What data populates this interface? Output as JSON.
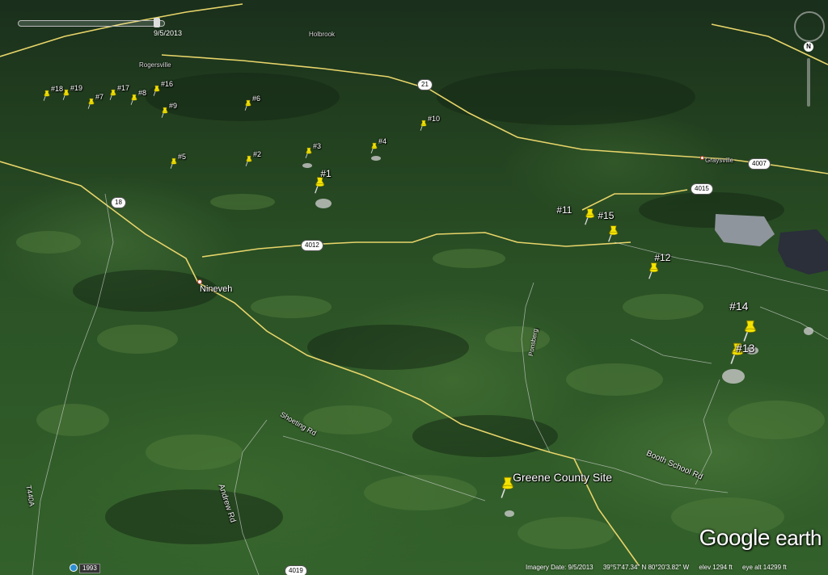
{
  "app": {
    "name": "Google Earth"
  },
  "time_slider": {
    "date": "9/5/2013"
  },
  "compass": {
    "north_label": "N"
  },
  "logo": {
    "brand": "Google",
    "product": "earth"
  },
  "status_bar": {
    "imagery_date": "Imagery Date: 9/5/2013",
    "coordinates": "39°57'47.34\" N   80°20'3.82\" W",
    "elevation": "elev  1294 ft",
    "eye_alt": "eye alt  14299 ft"
  },
  "historical_imagery_year": "1993",
  "towns": [
    {
      "id": "nineveh",
      "name": "Nineveh"
    },
    {
      "id": "graysville",
      "name": "Graysville"
    },
    {
      "id": "rogersville",
      "name": "Rogersville"
    },
    {
      "id": "holbrook",
      "name": "Holbrook"
    }
  ],
  "roads": [
    {
      "id": "andrew-rd",
      "name": "Andrew Rd"
    },
    {
      "id": "booth-school-rd",
      "name": "Booth School Rd"
    },
    {
      "id": "shoeting-rd",
      "name": "Shoeting Rd"
    },
    {
      "id": "ponsberg-rd",
      "name": "Ponsberg"
    },
    {
      "id": "t440a",
      "name": "T440A"
    }
  ],
  "route_shields": [
    {
      "id": "r18",
      "label": "18"
    },
    {
      "id": "r4012",
      "label": "4012"
    },
    {
      "id": "r4015",
      "label": "4015"
    },
    {
      "id": "r4007",
      "label": "4007"
    },
    {
      "id": "r4019",
      "label": "4019"
    },
    {
      "id": "r21",
      "label": "21"
    }
  ],
  "placemarks": [
    {
      "id": "p1",
      "label": "#1"
    },
    {
      "id": "p2",
      "label": "#2"
    },
    {
      "id": "p3",
      "label": "#3"
    },
    {
      "id": "p4",
      "label": "#4"
    },
    {
      "id": "p5",
      "label": "#5"
    },
    {
      "id": "p6",
      "label": "#6"
    },
    {
      "id": "p7",
      "label": "#7"
    },
    {
      "id": "p8",
      "label": "#8"
    },
    {
      "id": "p9",
      "label": "#9"
    },
    {
      "id": "p10",
      "label": "#10"
    },
    {
      "id": "p11",
      "label": "#11"
    },
    {
      "id": "p12",
      "label": "#12"
    },
    {
      "id": "p13",
      "label": "#13"
    },
    {
      "id": "p14",
      "label": "#14"
    },
    {
      "id": "p15",
      "label": "#15"
    },
    {
      "id": "p16",
      "label": "#16"
    },
    {
      "id": "p17",
      "label": "#17"
    },
    {
      "id": "p18",
      "label": "#18"
    },
    {
      "id": "p19",
      "label": "#19"
    },
    {
      "id": "greene",
      "label": "Greene County Site"
    }
  ],
  "colors": {
    "road": "#e8d56a",
    "pin": "#f5e400",
    "pond": "#2a2f3a",
    "clearing": "#c9c9c9"
  }
}
